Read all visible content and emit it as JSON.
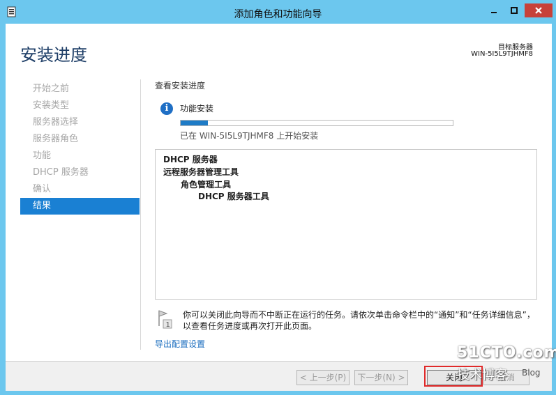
{
  "window": {
    "title": "添加角色和功能向导"
  },
  "header": {
    "page_title": "安装进度",
    "target_label": "目标服务器",
    "target_value": "WIN-5I5L9TJHMF8"
  },
  "nav": {
    "items": [
      {
        "label": "开始之前",
        "active": false
      },
      {
        "label": "安装类型",
        "active": false
      },
      {
        "label": "服务器选择",
        "active": false
      },
      {
        "label": "服务器角色",
        "active": false
      },
      {
        "label": "功能",
        "active": false
      },
      {
        "label": "DHCP 服务器",
        "active": false
      },
      {
        "label": "确认",
        "active": false
      },
      {
        "label": "结果",
        "active": true
      }
    ]
  },
  "content": {
    "section_heading": "查看安装进度",
    "feature_label": "功能安装",
    "progress_fraction": 0.1,
    "status_text": "已在 WIN-5I5L9TJHMF8 上开始安装",
    "results": [
      {
        "text": "DHCP 服务器",
        "level": 0
      },
      {
        "text": "远程服务器管理工具",
        "level": 0
      },
      {
        "text": "角色管理工具",
        "level": 1
      },
      {
        "text": "DHCP 服务器工具",
        "level": 2
      }
    ],
    "note_text": "你可以关闭此向导而不中断正在运行的任务。请依次单击命令栏中的“通知”和“任务详细信息”，以查看任务进度或再次打开此页面。",
    "export_link": "导出配置设置"
  },
  "footer": {
    "prev_label": "< 上一步(P)",
    "next_label": "下一步(N) >",
    "close_label": "关闭",
    "cancel_label": "取消"
  },
  "watermark": {
    "brand": "51CTO.com",
    "sub": "技术博客",
    "blog": "Blog"
  },
  "colors": {
    "titlebar": "#6cc7ee",
    "accent": "#1a80d3",
    "close_button": "#c7413a",
    "highlight": "#e02a2a"
  }
}
